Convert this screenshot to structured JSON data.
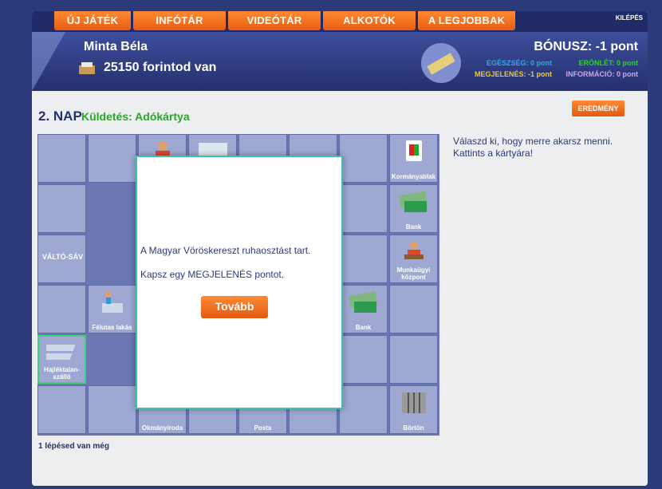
{
  "nav": {
    "items": [
      "ÚJ JÁTÉK",
      "INFÓTÁR",
      "VIDEÓTÁR",
      "ALKOTÓK",
      "A LEGJOBBAK"
    ],
    "logout": "KILÉPÉS"
  },
  "player": {
    "name": "Minta Béla",
    "money": "25150 forintod van"
  },
  "bonus": {
    "label": "BÓNUSZ: -1 pont"
  },
  "stats": {
    "health": "EGÉSZSÉG: 0 pont",
    "energy": "ERŐNLÉT: 0 pont",
    "appearance": "MEGJELENÉS: -1 pont",
    "information": "INFORMÁCIÓ: 0 pont"
  },
  "game": {
    "day": "2. NAP",
    "mission": "Küldetés: Adókártya",
    "result_button": "EREDMÉNY",
    "hint": "Válaszd ki, hogy merre akarsz menni. Kattints a kártyára!",
    "steps": "1 lépésed van még"
  },
  "board": {
    "labels": {
      "kormanyablak": "Kormányablak",
      "bank1": "Bank",
      "munkaugyi": "Munkaügyi központ",
      "bank2": "Bank",
      "borton": "Börtön",
      "posta": "Posta",
      "okmany": "Okmányiroda",
      "felutas": "Félutas lakás",
      "hajlektalan": "Hajléktalan-szálló",
      "valto": "VÁLTÓ-SÁV"
    }
  },
  "dialog": {
    "line1": "A Magyar Vöröskereszt ruhaosztást tart.",
    "line2": "Kapsz egy MEGJELENÉS pontot.",
    "button": "Tovább"
  },
  "colors": {
    "accent": "#e85d12",
    "board": "#9ea8d2",
    "navy": "#24306f",
    "green": "#2aa62a",
    "teal": "#3fc0aa"
  }
}
